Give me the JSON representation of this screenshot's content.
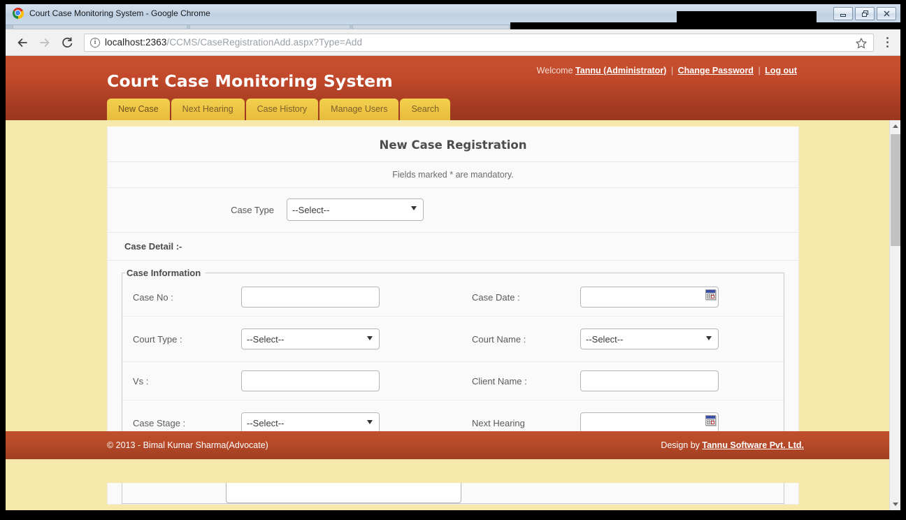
{
  "window": {
    "title": "Court Case Monitoring System - Google Chrome",
    "minimize_label": "Minimize",
    "restore_label": "Restore",
    "close_label": "Close"
  },
  "browser": {
    "back_label": "Back",
    "forward_label": "Forward",
    "reload_label": "Reload",
    "url_host": "localhost:2363",
    "url_path": "/CCMS/CaseRegistrationAdd.aspx?Type=Add",
    "bookmark_label": "Bookmark this page",
    "menu_label": "Customize and control Google Chrome"
  },
  "site": {
    "brand": "Court Case Monitoring System",
    "welcome_prefix": "Welcome",
    "user": "Tannu (Administrator)",
    "change_password": "Change Password",
    "log_out": "Log out",
    "separator": "|"
  },
  "nav": {
    "tabs": [
      {
        "label": "New Case",
        "active": true
      },
      {
        "label": "Next Hearing",
        "active": false
      },
      {
        "label": "Case History",
        "active": false
      },
      {
        "label": "Manage Users",
        "active": false
      },
      {
        "label": "Search",
        "active": false
      }
    ]
  },
  "form": {
    "title": "New Case Registration",
    "note": "Fields marked * are mandatory.",
    "case_type_label": "Case Type",
    "case_type_value": "--Select--",
    "section_heading": "Case Detail :-",
    "fieldset_legend": "Case Information",
    "fields": {
      "case_no_label": "Case No :",
      "case_no_value": "",
      "case_date_label": "Case Date :",
      "case_date_value": "",
      "court_type_label": "Court Type :",
      "court_type_value": "--Select--",
      "court_name_label": "Court Name :",
      "court_name_value": "--Select--",
      "vs_label": "Vs :",
      "vs_value": "",
      "client_name_label": "Client Name :",
      "client_name_value": "",
      "case_stage_label": "Case Stage :",
      "case_stage_value": "--Select--",
      "next_hearing_label": "Next Hearing",
      "next_hearing_value": "",
      "notes_value": ""
    },
    "select_placeholder": "--Select--"
  },
  "footer": {
    "copyright": "© 2013 - Bimal Kumar Sharma(Advocate)",
    "design_prefix": "Design by",
    "design_link": "Tannu Software Pvt. Ltd."
  },
  "colors": {
    "header_red": "#c2492b",
    "tab_gold": "#edc444",
    "page_cream": "#f7e9ac",
    "panel_white": "#fafafa",
    "footer_red": "#b84a29"
  }
}
